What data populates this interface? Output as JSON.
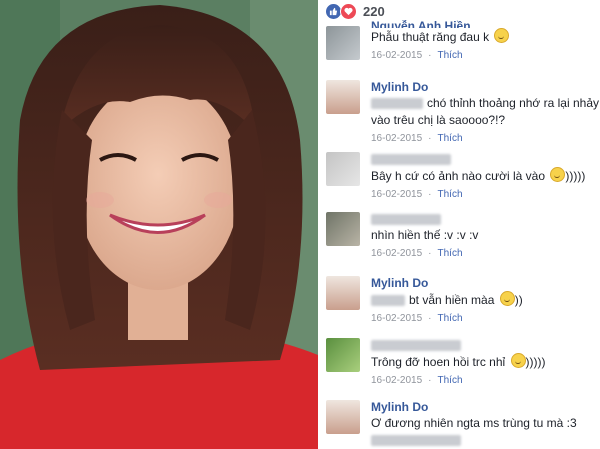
{
  "reactions": {
    "count": "220",
    "types": [
      "like-icon",
      "love-icon"
    ]
  },
  "comments": [
    {
      "author": "Nguyễn Anh Hiền",
      "text": "Phẫu thuật răng đau k",
      "emoji": true,
      "date": "16-02-2015",
      "action": "Thích"
    },
    {
      "author": "Mylinh Do",
      "text_line1": "chó thỉnh thoảng nhớ ra lại nhảy",
      "text_line2": "vào trêu chị là saoooo?!?",
      "date": "16-02-2015",
      "action": "Thích"
    },
    {
      "author": "",
      "text": "Bây h cứ có ảnh nào cười là vào",
      "emoji_suffix": ")))))",
      "date": "16-02-2015",
      "action": "Thích"
    },
    {
      "author": "",
      "text": "nhìn hiền thế :v :v :v",
      "date": "16-02-2015",
      "action": "Thích"
    },
    {
      "author": "Mylinh Do",
      "text": "bt vẫn hiền màa",
      "emoji_suffix": "))",
      "date": "16-02-2015",
      "action": "Thích"
    },
    {
      "author": "",
      "text": "Trông đỡ hoen hồi trc nhỉ",
      "emoji_suffix": ")))))",
      "date": "16-02-2015",
      "action": "Thích"
    },
    {
      "author": "Mylinh Do",
      "text": "Ơ đương nhiên ngta ms trùng tu mà :3"
    }
  ],
  "colors": {
    "link": "#365899",
    "accent": "#4267b2",
    "love": "#ed4956",
    "muted": "#90949c"
  }
}
